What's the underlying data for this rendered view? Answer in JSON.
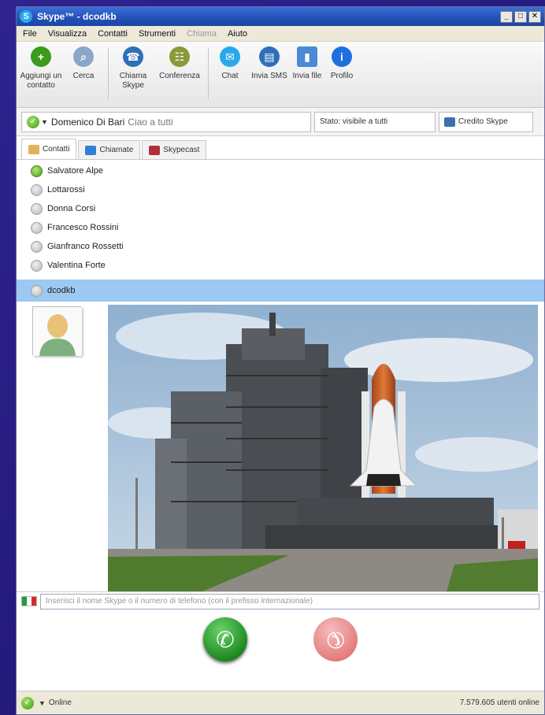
{
  "window": {
    "title": "Skype™ - dcodkb"
  },
  "menu": [
    "File",
    "Visualizza",
    "Contatti",
    "Strumenti",
    "Chiama",
    "Aiuto"
  ],
  "toolbar": [
    {
      "label": "Aggiungi un contatto",
      "icon": "add-contact-icon",
      "color": "#3d9a1a"
    },
    {
      "label": "Cerca",
      "icon": "search-people-icon",
      "color": "#8aa6c8"
    },
    {
      "label": "Chiama Skype",
      "icon": "phone-icon",
      "color": "#2f6fb8"
    },
    {
      "label": "Conferenza",
      "icon": "conference-icon",
      "color": "#8a9a3a"
    },
    {
      "label": "Chat",
      "icon": "chat-icon",
      "color": "#29a9ea"
    },
    {
      "label": "Invia SMS",
      "icon": "sms-icon",
      "color": "#2f6fb8"
    },
    {
      "label": "Invia file",
      "icon": "send-file-icon",
      "color": "#4a8ad6"
    },
    {
      "label": "Profilo",
      "icon": "info-icon",
      "color": "#1f6fe0"
    }
  ],
  "status": {
    "name": "Domenico Di Bari",
    "mood": "Ciao a tutti",
    "selector": "Stato: visibile a tutti",
    "credit": "Credito Skype"
  },
  "tabs": [
    {
      "label": "Contatti",
      "color": "#e0b25a"
    },
    {
      "label": "Chiamate",
      "color": "#2f7fd6"
    },
    {
      "label": "Skypecast",
      "color": "#b0303a"
    }
  ],
  "contacts": [
    {
      "name": "Salvatore Alpe",
      "online": true
    },
    {
      "name": "Lottarossi",
      "online": false
    },
    {
      "name": "Donna Corsi",
      "online": false
    },
    {
      "name": "Francesco Rossini",
      "online": false
    },
    {
      "name": "Gianfranco Rossetti",
      "online": false
    },
    {
      "name": "Valentina Forte",
      "online": false
    }
  ],
  "selected_contact": "dcodkb",
  "dial": {
    "placeholder": "Inserisci il nome Skype o il numero di telefono (con il prefisso internazionale)"
  },
  "bottom": {
    "status": "Online",
    "users_online": "7.579.605 utenti online"
  },
  "colors": {
    "titlebar": "#2250b8",
    "selection": "#9cc8f2",
    "call_green": "#1e8a21",
    "hangup_red": "#e06868"
  }
}
